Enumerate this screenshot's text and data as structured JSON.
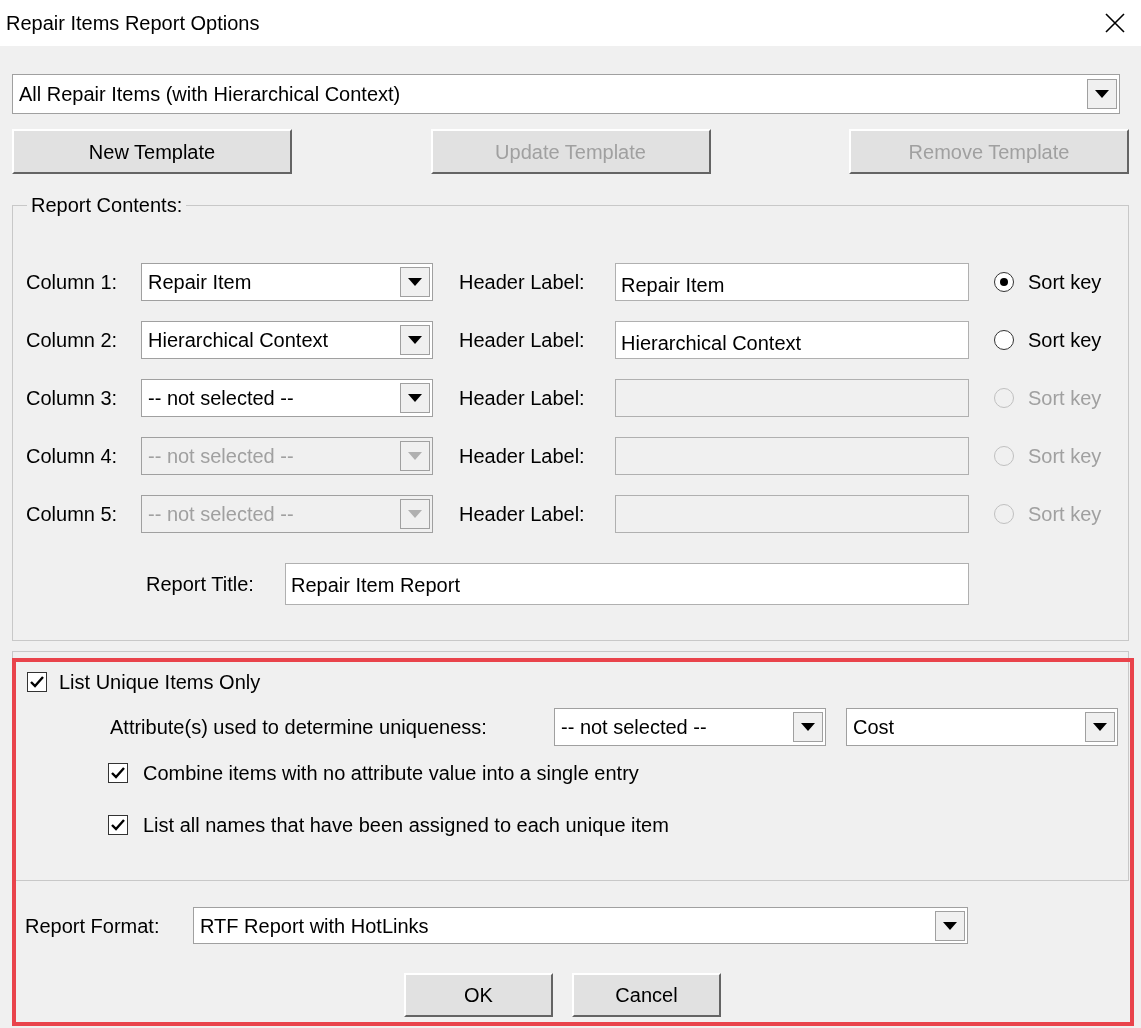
{
  "window": {
    "title": "Repair Items Report Options"
  },
  "template_select": {
    "value": "All Repair Items (with Hierarchical Context)"
  },
  "template_buttons": [
    {
      "label": "New Template",
      "disabled": false
    },
    {
      "label": "Update Template",
      "disabled": true
    },
    {
      "label": "Remove Template",
      "disabled": true
    }
  ],
  "report_contents": {
    "title": "Report Contents:",
    "columns": [
      {
        "label": "Column 1:",
        "value": "Repair Item",
        "disabled": false,
        "header_label": "Header Label:",
        "header_value": "Repair Item",
        "header_disabled": false,
        "sort_key": "Sort key",
        "selected": true
      },
      {
        "label": "Column 2:",
        "value": "Hierarchical Context",
        "disabled": false,
        "header_label": "Header Label:",
        "header_value": "Hierarchical Context",
        "header_disabled": false,
        "sort_key": "Sort key",
        "selected": false
      },
      {
        "label": "Column 3:",
        "value": "-- not selected --",
        "disabled": false,
        "header_label": "Header Label:",
        "header_disabled": true,
        "sort_key": "Sort key",
        "selected": false
      },
      {
        "label": "Column 4:",
        "value": "-- not selected --",
        "disabled": true,
        "header_label": "Header Label:",
        "header_disabled": true,
        "sort_key": "Sort key",
        "selected": false
      },
      {
        "label": "Column 5:",
        "value": "-- not selected --",
        "disabled": true,
        "header_label": "Header Label:",
        "header_disabled": true,
        "sort_key": "Sort key",
        "selected": false
      }
    ],
    "report_title": {
      "label": "Report Title:",
      "value": "Repair Item Report"
    }
  },
  "unique": {
    "label": "List Unique Items Only",
    "checked": true,
    "attribute_label": "Attribute(s) used to determine uniqueness:",
    "attributes": [
      "-- not selected --",
      "Cost"
    ],
    "options": [
      {
        "label": "Combine items with no attribute value into a single entry",
        "checked": true
      },
      {
        "label": "List all names that have been assigned to each unique item",
        "checked": true
      }
    ]
  },
  "report_format": {
    "label": "Report Format:",
    "value": "RTF Report with HotLinks"
  },
  "buttons": [
    "OK",
    "Cancel"
  ]
}
